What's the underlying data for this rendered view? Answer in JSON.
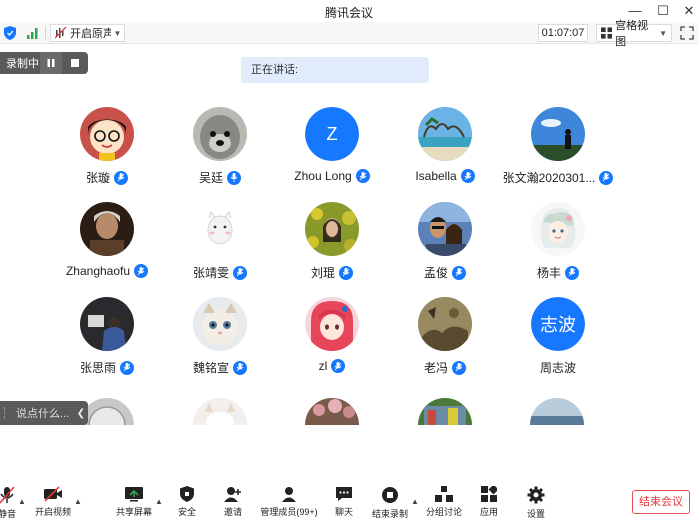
{
  "window": {
    "title": "腾讯会议",
    "minimize": "—",
    "maximize": "☐",
    "close": "✕"
  },
  "toolbar": {
    "audio_label": "开启原声",
    "timer": "01:07:07",
    "view_label": "宫格视图"
  },
  "recording": {
    "label": "录制中"
  },
  "speaking": {
    "label": "正在讲话:"
  },
  "participants": [
    {
      "name": "张璇"
    },
    {
      "name": "吴廷"
    },
    {
      "name": "Zhou Long",
      "initial": "Z"
    },
    {
      "name": "Isabella"
    },
    {
      "name": "张文瀚2020301..."
    },
    {
      "name": "Zhanghaofu"
    },
    {
      "name": "张靖雯"
    },
    {
      "name": "刘琨"
    },
    {
      "name": "孟俊"
    },
    {
      "name": "杨丰"
    },
    {
      "name": "张思雨"
    },
    {
      "name": "魏铭宣"
    },
    {
      "name": "zl"
    },
    {
      "name": "老冯"
    },
    {
      "name": "周志波",
      "initial": "志波"
    }
  ],
  "chat": {
    "placeholder": "说点什么..."
  },
  "bottombar": {
    "mute": "静音",
    "video": "开启视频",
    "share": "共享屏幕",
    "security": "安全",
    "invite": "邀请",
    "members": "管理成员(99+)",
    "chat": "聊天",
    "end_record": "结束录制",
    "breakout": "分组讨论",
    "apps": "应用",
    "settings": "设置",
    "end_meeting": "结束会议"
  },
  "colors": {
    "accent": "#1677ff",
    "danger": "#e03a3a",
    "overlay": "#5a5a5a"
  }
}
